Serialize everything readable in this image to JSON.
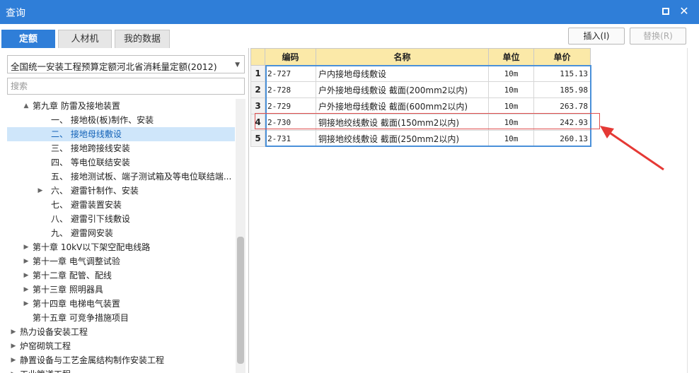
{
  "window": {
    "title": "查询",
    "maximize_icon": "maximize-icon",
    "close_icon": "close-icon"
  },
  "tabs": [
    {
      "label": "定额",
      "active": true
    },
    {
      "label": "人材机",
      "active": false
    },
    {
      "label": "我的数据",
      "active": false
    }
  ],
  "actions": {
    "insert_label": "插入(I)",
    "replace_label": "替换(R)"
  },
  "left": {
    "library_select": "全国统一安装工程预算定额河北省消耗量定额(2012)",
    "search_placeholder": "搜索",
    "tree": [
      {
        "label": "第九章 防雷及接地装置",
        "arrow": "▲",
        "level": 2
      },
      {
        "label": "一、  接地极(板)制作、安装",
        "arrow": "",
        "level": 3
      },
      {
        "label": "二、  接地母线敷设",
        "arrow": "",
        "level": 3,
        "selected": true
      },
      {
        "label": "三、  接地跨接线安装",
        "arrow": "",
        "level": 3
      },
      {
        "label": "四、  等电位联结安装",
        "arrow": "",
        "level": 3
      },
      {
        "label": "五、  接地测试板、端子测试箱及等电位联结端...",
        "arrow": "",
        "level": 3
      },
      {
        "label": "六、  避雷针制作、安装",
        "arrow": "▶",
        "level": 3
      },
      {
        "label": "七、  避雷装置安装",
        "arrow": "",
        "level": 3
      },
      {
        "label": "八、  避雷引下线敷设",
        "arrow": "",
        "level": 3
      },
      {
        "label": "九、  避雷网安装",
        "arrow": "",
        "level": 3
      },
      {
        "label": "第十章 10kV以下架空配电线路",
        "arrow": "▶",
        "level": 2
      },
      {
        "label": "第十一章 电气调整试验",
        "arrow": "▶",
        "level": 2
      },
      {
        "label": "第十二章 配管、配线",
        "arrow": "▶",
        "level": 2
      },
      {
        "label": "第十三章 照明器具",
        "arrow": "▶",
        "level": 2
      },
      {
        "label": "第十四章 电梯电气装置",
        "arrow": "▶",
        "level": 2
      },
      {
        "label": "第十五章 可竞争措施项目",
        "arrow": "",
        "level": 2
      },
      {
        "label": "热力设备安装工程",
        "arrow": "▶",
        "level": 1
      },
      {
        "label": "炉窑砌筑工程",
        "arrow": "▶",
        "level": 1
      },
      {
        "label": "静置设备与工艺金属结构制作安装工程",
        "arrow": "▶",
        "level": 1
      },
      {
        "label": "工业管道工程",
        "arrow": "▶",
        "level": 1
      }
    ]
  },
  "grid": {
    "headers": [
      "",
      "编码",
      "名称",
      "单位",
      "单价"
    ],
    "rows": [
      {
        "idx": "1",
        "code": "2-727",
        "name": "户内接地母线敷设",
        "unit": "10m",
        "price": "115.13"
      },
      {
        "idx": "2",
        "code": "2-728",
        "name": "户外接地母线敷设 截面(200mm2以内)",
        "unit": "10m",
        "price": "185.98"
      },
      {
        "idx": "3",
        "code": "2-729",
        "name": "户外接地母线敷设 截面(600mm2以内)",
        "unit": "10m",
        "price": "263.78"
      },
      {
        "idx": "4",
        "code": "2-730",
        "name": "铜接地绞线敷设 截面(150mm2以内)",
        "unit": "10m",
        "price": "242.93",
        "highlighted": true
      },
      {
        "idx": "5",
        "code": "2-731",
        "name": "铜接地绞线敷设 截面(250mm2以内)",
        "unit": "10m",
        "price": "260.13"
      }
    ]
  },
  "colors": {
    "accent": "#2f7ed8",
    "header_bg": "#fbe9a8",
    "selection": "#cfe6fa",
    "annotation": "#e53935"
  }
}
